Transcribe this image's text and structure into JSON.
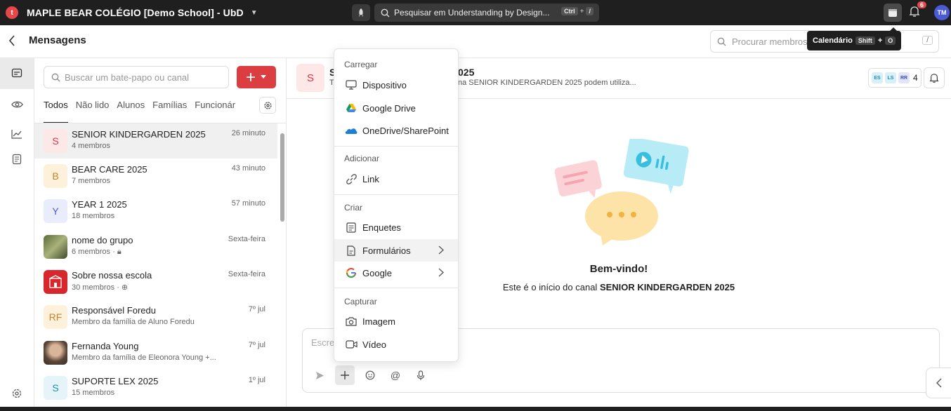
{
  "topbar": {
    "logo_letter": "t",
    "school_name": "MAPLE BEAR COLÉGIO [Demo School] - UbD",
    "search_placeholder": "Pesquisar em Understanding by Design...",
    "search_key1": "Ctrl",
    "search_plus": "+",
    "search_key2": "/",
    "notifications_count": "6",
    "user_initials": "TM"
  },
  "header": {
    "title": "Mensagens",
    "member_search_placeholder": "Procurar membros",
    "member_search_shortcut": "/"
  },
  "tooltip": {
    "label": "Calendário",
    "key1": "Shift",
    "plus": "+",
    "key2": "O"
  },
  "chat_panel": {
    "search_placeholder": "Buscar um bate-papo ou canal",
    "tabs": [
      "Todos",
      "Não lido",
      "Alunos",
      "Famílias",
      "Funcionár"
    ],
    "items": [
      {
        "initials": "S",
        "name": "SENIOR KINDERGARDEN 2025",
        "sub": "4 membros",
        "time": "26 minuto"
      },
      {
        "initials": "B",
        "name": "BEAR CARE 2025",
        "sub": "7 membros",
        "time": "43 minuto"
      },
      {
        "initials": "Y",
        "name": "YEAR 1 2025",
        "sub": "18 membros",
        "time": "57 minuto"
      },
      {
        "initials": "",
        "name": "nome do grupo",
        "sub": "6 membros",
        "time": "Sexta-feira"
      },
      {
        "initials": "",
        "name": "Sobre nossa escola",
        "sub": "30 membros",
        "time": "Sexta-feira"
      },
      {
        "initials": "RF",
        "name": "Responsável Foredu",
        "sub": "Membro da família de Aluno Foredu",
        "time": "7º jul"
      },
      {
        "initials": "",
        "name": "Fernanda Young",
        "sub": "Membro da família de Eleonora Young +...",
        "time": "7º jul"
      },
      {
        "initials": "S",
        "name": "SUPORTE LEX 2025",
        "sub": "15 membros",
        "time": "1º jul"
      }
    ]
  },
  "channel": {
    "avatar": "S",
    "title_visible": "S",
    "title_tail": "025",
    "desc_head": "T",
    "desc_tail": "na SENIOR KINDERGARDEN 2025 podem utiliza...",
    "member_chips": [
      "ES",
      "LS",
      "RR"
    ],
    "member_count": "4",
    "welcome_title": "Bem-vindo!",
    "welcome_prefix": "Este é o início do canal",
    "welcome_channel": "SENIOR KINDERGARDEN 2025",
    "composer_placeholder": "Escreva"
  },
  "menu": {
    "sections": [
      {
        "title": "Carregar",
        "items": [
          {
            "icon": "monitor-icon",
            "label": "Dispositivo"
          },
          {
            "icon": "google-drive-icon",
            "label": "Google Drive"
          },
          {
            "icon": "onedrive-icon",
            "label": "OneDrive/SharePoint"
          }
        ]
      },
      {
        "title": "Adicionar",
        "items": [
          {
            "icon": "link-icon",
            "label": "Link"
          }
        ]
      },
      {
        "title": "Criar",
        "items": [
          {
            "icon": "poll-icon",
            "label": "Enquetes"
          },
          {
            "icon": "form-icon",
            "label": "Formulários"
          },
          {
            "icon": "google-icon",
            "label": "Google"
          }
        ]
      },
      {
        "title": "Capturar",
        "items": [
          {
            "icon": "camera-icon",
            "label": "Imagem"
          },
          {
            "icon": "video-icon",
            "label": "Vídeo"
          }
        ]
      }
    ]
  },
  "colors": {
    "accent_red": "#dc3d40",
    "topbar_bg": "#1f1f1f"
  }
}
